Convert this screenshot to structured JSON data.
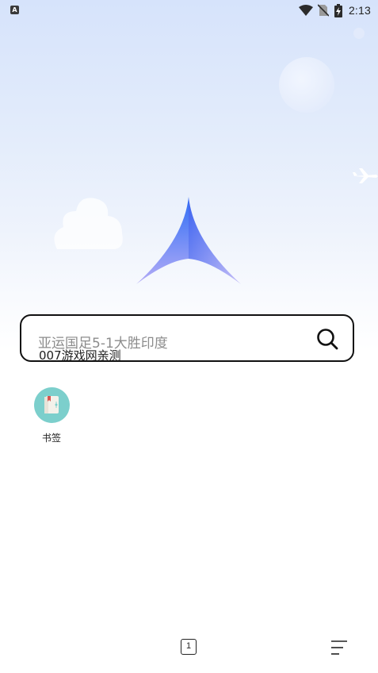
{
  "status_bar": {
    "app_icon_glyph": "A",
    "time": "2:13",
    "icons": [
      "wifi-icon",
      "no-sim-icon",
      "battery-charging-icon"
    ]
  },
  "search": {
    "placeholder": "亚运国足5-1大胜印度",
    "suggestion": "007游戏网亲测"
  },
  "shortcuts": [
    {
      "label": "书签",
      "icon": "bookmark-book-icon",
      "color": "#7ccfcc"
    }
  ],
  "bottom_nav": {
    "tab_count": "1",
    "menu_icon": "menu-lines-icon"
  },
  "colors": {
    "logo_top": "#2f6ef5",
    "logo_bottom": "#b3a8f5",
    "sky_top": "#d6e3fb"
  }
}
